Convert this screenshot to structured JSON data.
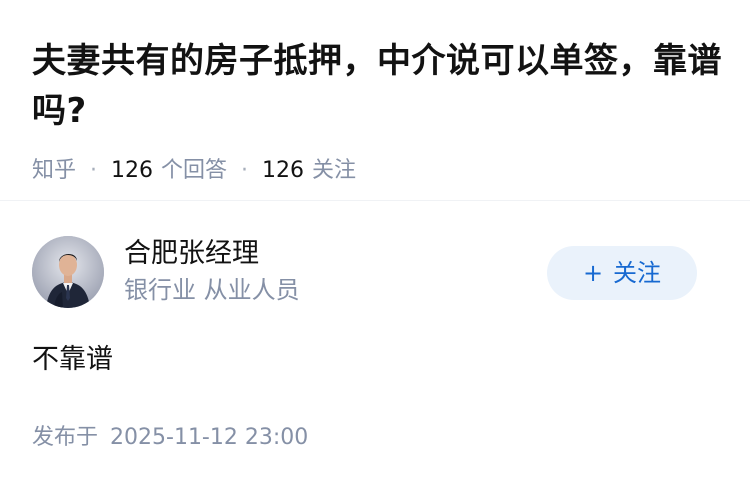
{
  "question": {
    "title": "夫妻共有的房子抵押，中介说可以单签，靠谱吗?",
    "meta": {
      "source": "知乎",
      "answers_count": "126",
      "answers_label": "个回答",
      "followers_count": "126",
      "followers_label": "关注",
      "separator": "·"
    }
  },
  "author": {
    "name": "合肥张经理",
    "badge": "银行业 从业人员",
    "avatar_icon": "person-avatar-icon",
    "follow_label": "关注",
    "follow_icon": "+"
  },
  "answer": {
    "content": "不靠谱",
    "time_label": "发布于",
    "time_value": "2025-11-12 23:00"
  },
  "colors": {
    "title": "#121212",
    "meta": "#8590a6",
    "follow_bg": "#eaf2fb",
    "follow_text": "#1769d1"
  }
}
